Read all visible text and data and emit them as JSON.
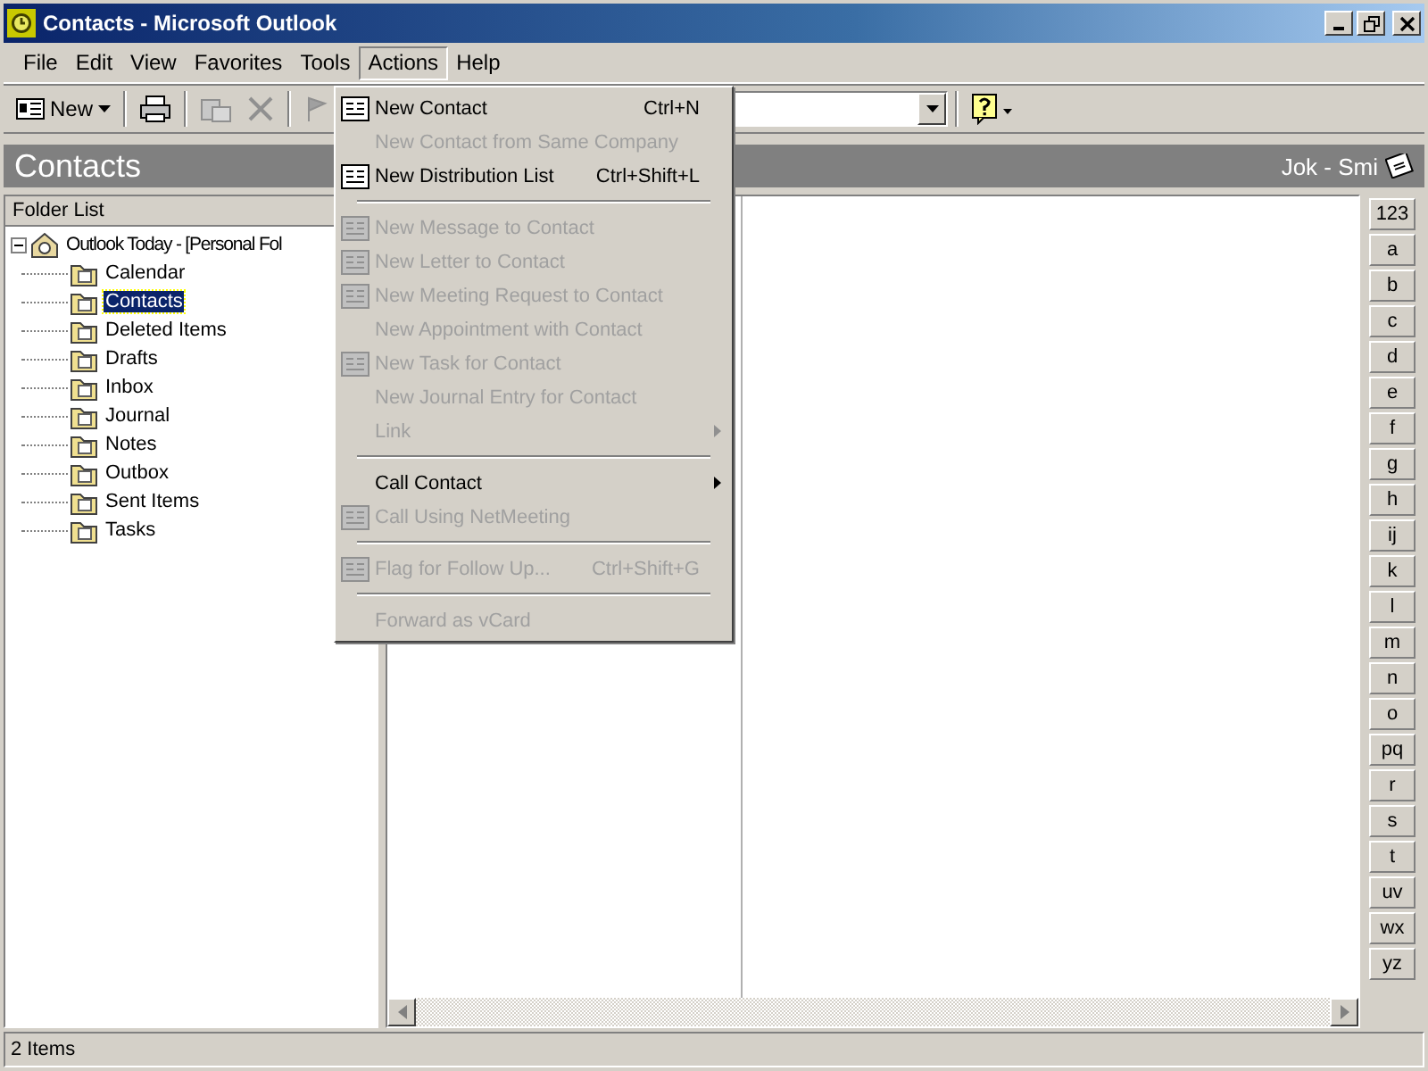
{
  "window": {
    "title": "Contacts - Microsoft Outlook"
  },
  "menu_bar": [
    {
      "label": "File",
      "selected": false
    },
    {
      "label": "Edit",
      "selected": false
    },
    {
      "label": "View",
      "selected": false
    },
    {
      "label": "Favorites",
      "selected": false
    },
    {
      "label": "Tools",
      "selected": false
    },
    {
      "label": "Actions",
      "selected": true
    },
    {
      "label": "Help",
      "selected": false
    }
  ],
  "toolbar": {
    "new_button": "New"
  },
  "header": {
    "title": "Contacts",
    "range": "Jok - Smi"
  },
  "folder_list": {
    "title": "Folder List",
    "root": {
      "label": "Outlook Today - [Personal Fol",
      "expanded": true,
      "children": [
        {
          "label": "Calendar",
          "selected": false
        },
        {
          "label": "Contacts",
          "selected": true
        },
        {
          "label": "Deleted Items",
          "selected": false
        },
        {
          "label": "Drafts",
          "selected": false
        },
        {
          "label": "Inbox",
          "selected": false
        },
        {
          "label": "Journal",
          "selected": false
        },
        {
          "label": "Notes",
          "selected": false
        },
        {
          "label": "Outbox",
          "selected": false
        },
        {
          "label": "Sent Items",
          "selected": false
        },
        {
          "label": "Tasks",
          "selected": false
        }
      ]
    }
  },
  "actions_menu": [
    {
      "kind": "item",
      "label": "New Contact",
      "shortcut": "Ctrl+N",
      "icon": true,
      "disabled": false,
      "submenu": false
    },
    {
      "kind": "item",
      "label": "New Contact from Same Company",
      "icon": false,
      "disabled": true,
      "submenu": false
    },
    {
      "kind": "item",
      "label": "New Distribution List",
      "shortcut": "Ctrl+Shift+L",
      "icon": true,
      "disabled": false,
      "submenu": false
    },
    {
      "kind": "separator"
    },
    {
      "kind": "item",
      "label": "New Message to Contact",
      "icon": true,
      "disabled": true,
      "submenu": false
    },
    {
      "kind": "item",
      "label": "New Letter to Contact",
      "icon": true,
      "disabled": true,
      "submenu": false
    },
    {
      "kind": "item",
      "label": "New Meeting Request to Contact",
      "icon": true,
      "disabled": true,
      "submenu": false
    },
    {
      "kind": "item",
      "label": "New Appointment with Contact",
      "icon": false,
      "disabled": true,
      "submenu": false
    },
    {
      "kind": "item",
      "label": "New Task for Contact",
      "icon": true,
      "disabled": true,
      "submenu": false
    },
    {
      "kind": "item",
      "label": "New Journal Entry for Contact",
      "icon": false,
      "disabled": true,
      "submenu": false
    },
    {
      "kind": "item",
      "label": "Link",
      "icon": false,
      "disabled": true,
      "submenu": true
    },
    {
      "kind": "separator"
    },
    {
      "kind": "item",
      "label": "Call Contact",
      "icon": false,
      "disabled": false,
      "submenu": true
    },
    {
      "kind": "item",
      "label": "Call Using NetMeeting",
      "icon": true,
      "disabled": true,
      "submenu": false
    },
    {
      "kind": "separator"
    },
    {
      "kind": "item",
      "label": "Flag for Follow Up...",
      "shortcut": "Ctrl+Shift+G",
      "icon": true,
      "disabled": true,
      "submenu": false
    },
    {
      "kind": "separator"
    },
    {
      "kind": "item",
      "label": "Forward as vCard",
      "icon": false,
      "disabled": true,
      "submenu": false
    }
  ],
  "alphabet_index": [
    "123",
    "a",
    "b",
    "c",
    "d",
    "e",
    "f",
    "g",
    "h",
    "ij",
    "k",
    "l",
    "m",
    "n",
    "o",
    "pq",
    "r",
    "s",
    "t",
    "uv",
    "wx",
    "yz"
  ],
  "status_bar": {
    "text": "2 Items"
  }
}
